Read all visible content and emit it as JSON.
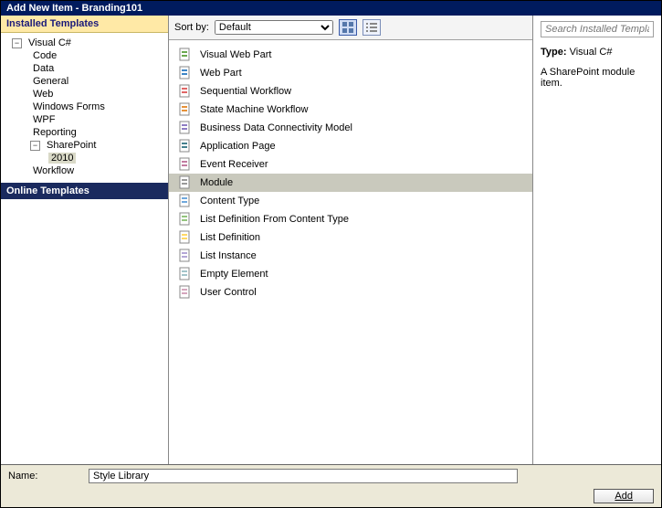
{
  "title": "Add New Item - Branding101",
  "sidebar": {
    "installed_header": "Installed Templates",
    "online_header": "Online Templates",
    "tree": [
      {
        "label": "Visual C#",
        "depth": 0,
        "toggle": "−"
      },
      {
        "label": "Code",
        "depth": 1
      },
      {
        "label": "Data",
        "depth": 1
      },
      {
        "label": "General",
        "depth": 1
      },
      {
        "label": "Web",
        "depth": 1
      },
      {
        "label": "Windows Forms",
        "depth": 1
      },
      {
        "label": "WPF",
        "depth": 1
      },
      {
        "label": "Reporting",
        "depth": 1
      },
      {
        "label": "SharePoint",
        "depth": 1,
        "toggle": "−"
      },
      {
        "label": "2010",
        "depth": 2,
        "selected": true
      },
      {
        "label": "Workflow",
        "depth": 1
      }
    ]
  },
  "toolbar": {
    "sort_label": "Sort by:",
    "sort_value": "Default"
  },
  "templates": [
    {
      "label": "Visual Web Part"
    },
    {
      "label": "Web Part"
    },
    {
      "label": "Sequential Workflow"
    },
    {
      "label": "State Machine Workflow"
    },
    {
      "label": "Business Data Connectivity Model"
    },
    {
      "label": "Application Page"
    },
    {
      "label": "Event Receiver"
    },
    {
      "label": "Module",
      "selected": true
    },
    {
      "label": "Content Type"
    },
    {
      "label": "List Definition From Content Type"
    },
    {
      "label": "List Definition"
    },
    {
      "label": "List Instance"
    },
    {
      "label": "Empty Element"
    },
    {
      "label": "User Control"
    }
  ],
  "details": {
    "search_placeholder": "Search Installed Templates",
    "type_label": "Type:",
    "type_value": "Visual C#",
    "description": "A SharePoint module item."
  },
  "footer": {
    "name_label": "Name:",
    "name_value": "Style Library",
    "add_button": "Add"
  }
}
